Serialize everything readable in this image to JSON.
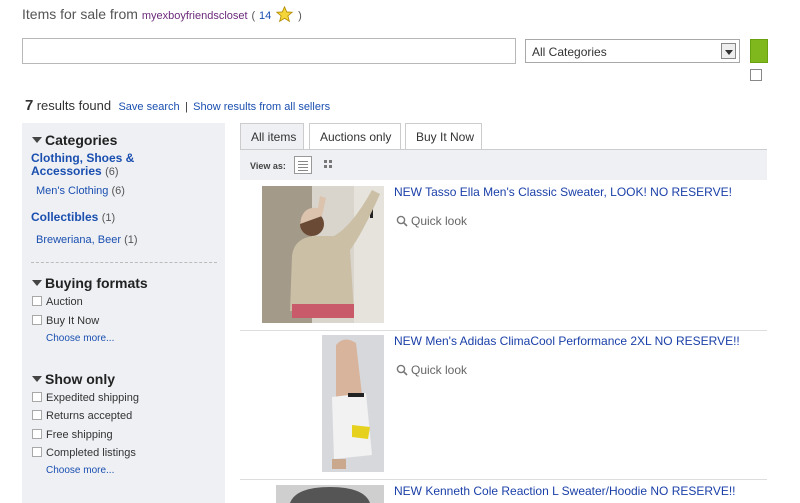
{
  "header": {
    "prefix": "Items for sale from",
    "seller": "myexboyfriendscloset",
    "open_paren": "(",
    "feedback_score": "14",
    "close_paren": ")",
    "star_icon": "star-icon"
  },
  "search": {
    "query": "",
    "category_selected": "All Categories"
  },
  "results": {
    "count": "7",
    "label": "results found",
    "save_search": "Save search",
    "separator": "|",
    "all_sellers": "Show results from all sellers"
  },
  "sidebar": {
    "categories": {
      "title": "Categories",
      "groups": [
        {
          "name": "Clothing, Shoes & Accessories",
          "count": "(6)",
          "sub_name": "Men's Clothing",
          "sub_count": "(6)"
        },
        {
          "name": "Collectibles",
          "count": "(1)",
          "sub_name": "Breweriana, Beer",
          "sub_count": "(1)"
        }
      ]
    },
    "buying_formats": {
      "title": "Buying formats",
      "options": [
        "Auction",
        "Buy It Now"
      ],
      "more": "Choose more..."
    },
    "show_only": {
      "title": "Show only",
      "options": [
        "Expedited shipping",
        "Returns accepted",
        "Free shipping",
        "Completed listings"
      ],
      "more": "Choose more..."
    }
  },
  "tabs": [
    "All items",
    "Auctions only",
    "Buy It Now"
  ],
  "view": {
    "label": "View as:"
  },
  "items": [
    {
      "title": "NEW Tasso Ella Men's Classic Sweater, LOOK! NO RESERVE!",
      "quick_look": "Quick look"
    },
    {
      "title": "NEW Men's Adidas ClimaCool Performance 2XL NO RESERVE!!",
      "quick_look": "Quick look"
    },
    {
      "title": "NEW Kenneth Cole Reaction L Sweater/Hoodie NO RESERVE!!"
    }
  ],
  "colors": {
    "link": "#1a4fb0",
    "seller": "#6b2a7a",
    "go_button": "#7fb81c",
    "sidebar_bg": "#eef0f4"
  }
}
